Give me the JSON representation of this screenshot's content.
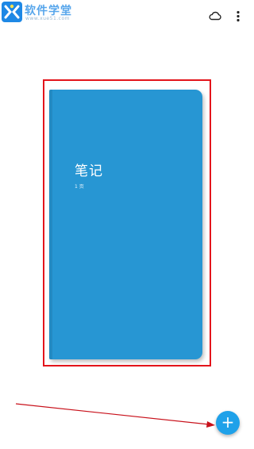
{
  "watermark": {
    "title": "软件学堂",
    "url": "www.xue51.com",
    "logo_icon": "x-logo-icon"
  },
  "toolbar": {
    "cloud_icon": "cloud-icon",
    "more_icon": "more-vertical-icon"
  },
  "notebook": {
    "title": "笔记",
    "pages": "1 页",
    "color": "#2796d3"
  },
  "fab": {
    "label": "+",
    "icon": "plus-icon",
    "color": "#1fa1e9"
  },
  "annotation": {
    "frame_color": "#e3141b",
    "arrow_color": "#c8101a"
  }
}
